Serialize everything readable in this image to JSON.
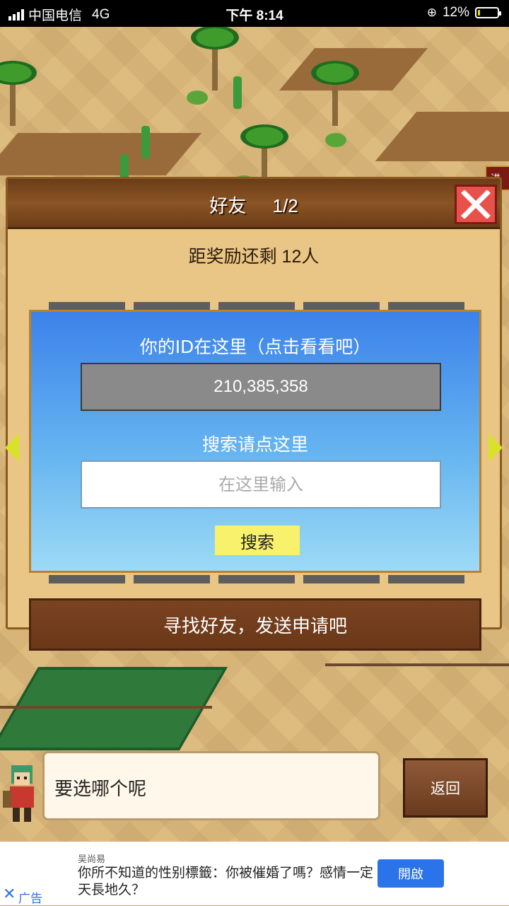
{
  "status_bar": {
    "carrier": "中国电信",
    "network": "4G",
    "time": "下午 8:14",
    "battery_percent": "12%",
    "battery_level": 0.12
  },
  "game": {
    "top_badge": "进"
  },
  "friends_panel": {
    "title": "好友",
    "page": "1/2",
    "reward_text": "距奖励还剩 12人",
    "id_label": "你的ID在这里（点击看看吧）",
    "id_value": "210,385,358",
    "search_label": "搜索请点这里",
    "search_placeholder": "在这里输入",
    "search_button": "搜索",
    "find_button": "寻找好友，发送申请吧"
  },
  "bottom": {
    "dialog_text": "要选哪个呢",
    "back_button": "返回"
  },
  "ad": {
    "source": "吴尚易",
    "text": "你所不知道的性别標籤：你被催婚了嗎？感情一定天長地久？",
    "open_button": "開啟",
    "close_label": "✕",
    "ad_label": "广告"
  },
  "colors": {
    "panel_header": "#8a5424",
    "search_area_top": "#3c82ea",
    "search_button": "#f7f16c",
    "close_button": "#e7514a",
    "ad_button": "#2a73e8"
  },
  "icons": [
    "signal-icon",
    "rotation-lock-icon",
    "battery-icon",
    "close-icon",
    "left-arrow-icon",
    "right-arrow-icon",
    "character-avatar"
  ]
}
